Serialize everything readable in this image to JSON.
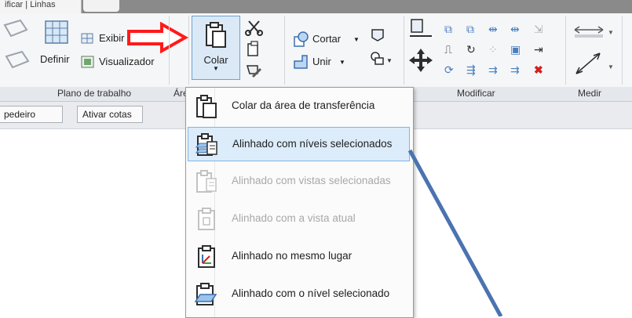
{
  "tabs": {
    "active": "ificar | Linhas"
  },
  "panels": {
    "plano": {
      "label": "Plano de trabalho",
      "definir": "Definir",
      "exibir": "Exibir",
      "visualizador": "Visualizador"
    },
    "area": {
      "label_partial": "Áre"
    },
    "clipboard": {
      "colar": "Colar"
    },
    "geometry": {
      "cortar": "Cortar",
      "unir": "Unir"
    },
    "modificar": {
      "label": "Modificar"
    },
    "medir": {
      "label": "Medir"
    }
  },
  "options_bar": {
    "left_button": "pedeiro",
    "ativar_cotas": "Ativar cotas"
  },
  "paste_menu": {
    "items": [
      {
        "label": "Colar da área de transferência",
        "enabled": true
      },
      {
        "label": "Alinhado com níveis selecionados",
        "enabled": true,
        "highlighted": true
      },
      {
        "label": "Alinhado com vistas selecionadas",
        "enabled": false
      },
      {
        "label": "Alinhado com a vista atual",
        "enabled": false
      },
      {
        "label": "Alinhado no mesmo lugar",
        "enabled": true
      },
      {
        "label": "Alinhado com o nível selecionado",
        "enabled": true
      }
    ]
  },
  "colors": {
    "arrow": "#ff1a1a",
    "pointer_line": "#4a73b0",
    "highlight": "#dcecfb",
    "highlight_border": "#7eb4ea"
  },
  "annotations": {
    "red_arrow": "pointing-right",
    "blue_line": "diagonal-pointer"
  }
}
